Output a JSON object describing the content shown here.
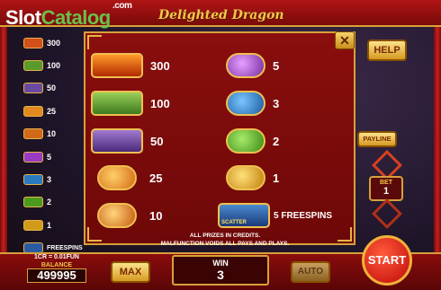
{
  "header": {
    "logo_part1": "Slot",
    "logo_part2": "Catalog",
    "logo_suffix": ".com",
    "game_title": "Delighted Dragon"
  },
  "mini_paytable": [
    {
      "icon": "dragon-symbol-icon",
      "value": "300",
      "color": "#d2501a"
    },
    {
      "icon": "panda-symbol-icon",
      "value": "100",
      "color": "#5a9a2a"
    },
    {
      "icon": "warrior-symbol-icon",
      "value": "50",
      "color": "#6a4aa0"
    },
    {
      "icon": "coin-a-icon",
      "value": "25",
      "color": "#e08a20"
    },
    {
      "icon": "coin-k-icon",
      "value": "10",
      "color": "#d06a18"
    },
    {
      "icon": "coin-q-icon",
      "value": "5",
      "color": "#9a3ac0"
    },
    {
      "icon": "coin-j-icon",
      "value": "3",
      "color": "#2a7ac0"
    },
    {
      "icon": "coin-10-icon",
      "value": "2",
      "color": "#4a9a20"
    },
    {
      "icon": "coin-9-icon",
      "value": "1",
      "color": "#d09a1a"
    },
    {
      "icon": "scatter-symbol-icon",
      "value": "FREESPINS",
      "color": "#2a5aa0"
    }
  ],
  "paytable": {
    "left": [
      {
        "icon": "dragon-symbol-icon",
        "value": "300"
      },
      {
        "icon": "panda-symbol-icon",
        "value": "100"
      },
      {
        "icon": "warrior-symbol-icon",
        "value": "50"
      },
      {
        "icon": "coin-a-icon",
        "value": "25"
      },
      {
        "icon": "coin-k-icon",
        "value": "10"
      }
    ],
    "right": [
      {
        "icon": "coin-q-icon",
        "value": "5"
      },
      {
        "icon": "coin-j-icon",
        "value": "3"
      },
      {
        "icon": "coin-10-icon",
        "value": "2"
      },
      {
        "icon": "coin-9-icon",
        "value": "1"
      },
      {
        "icon": "scatter-symbol-icon",
        "value": "5 FREESPINS",
        "badge": "SCATTER"
      }
    ],
    "note_line1": "ALL PRIZES IN CREDITS.",
    "note_line2": "MALFUNCTION VOIDS ALL PAYS AND PLAYS."
  },
  "controls": {
    "close_label": "✕",
    "help_label": "HELP",
    "payline_label": "PAYLINE",
    "bet_label": "BET",
    "bet_value": "1",
    "coin_info": "1CR = 0.01FUN",
    "balance_label": "BALANCE",
    "balance_value": "499995",
    "max_label": "MAX",
    "win_label": "WIN",
    "win_value": "3",
    "auto_label": "AUTO",
    "start_label": "START"
  },
  "colors": {
    "frame_red": "#8a0e0e",
    "gold_border": "#d7a03a",
    "title_gold": "#f3c64b"
  }
}
